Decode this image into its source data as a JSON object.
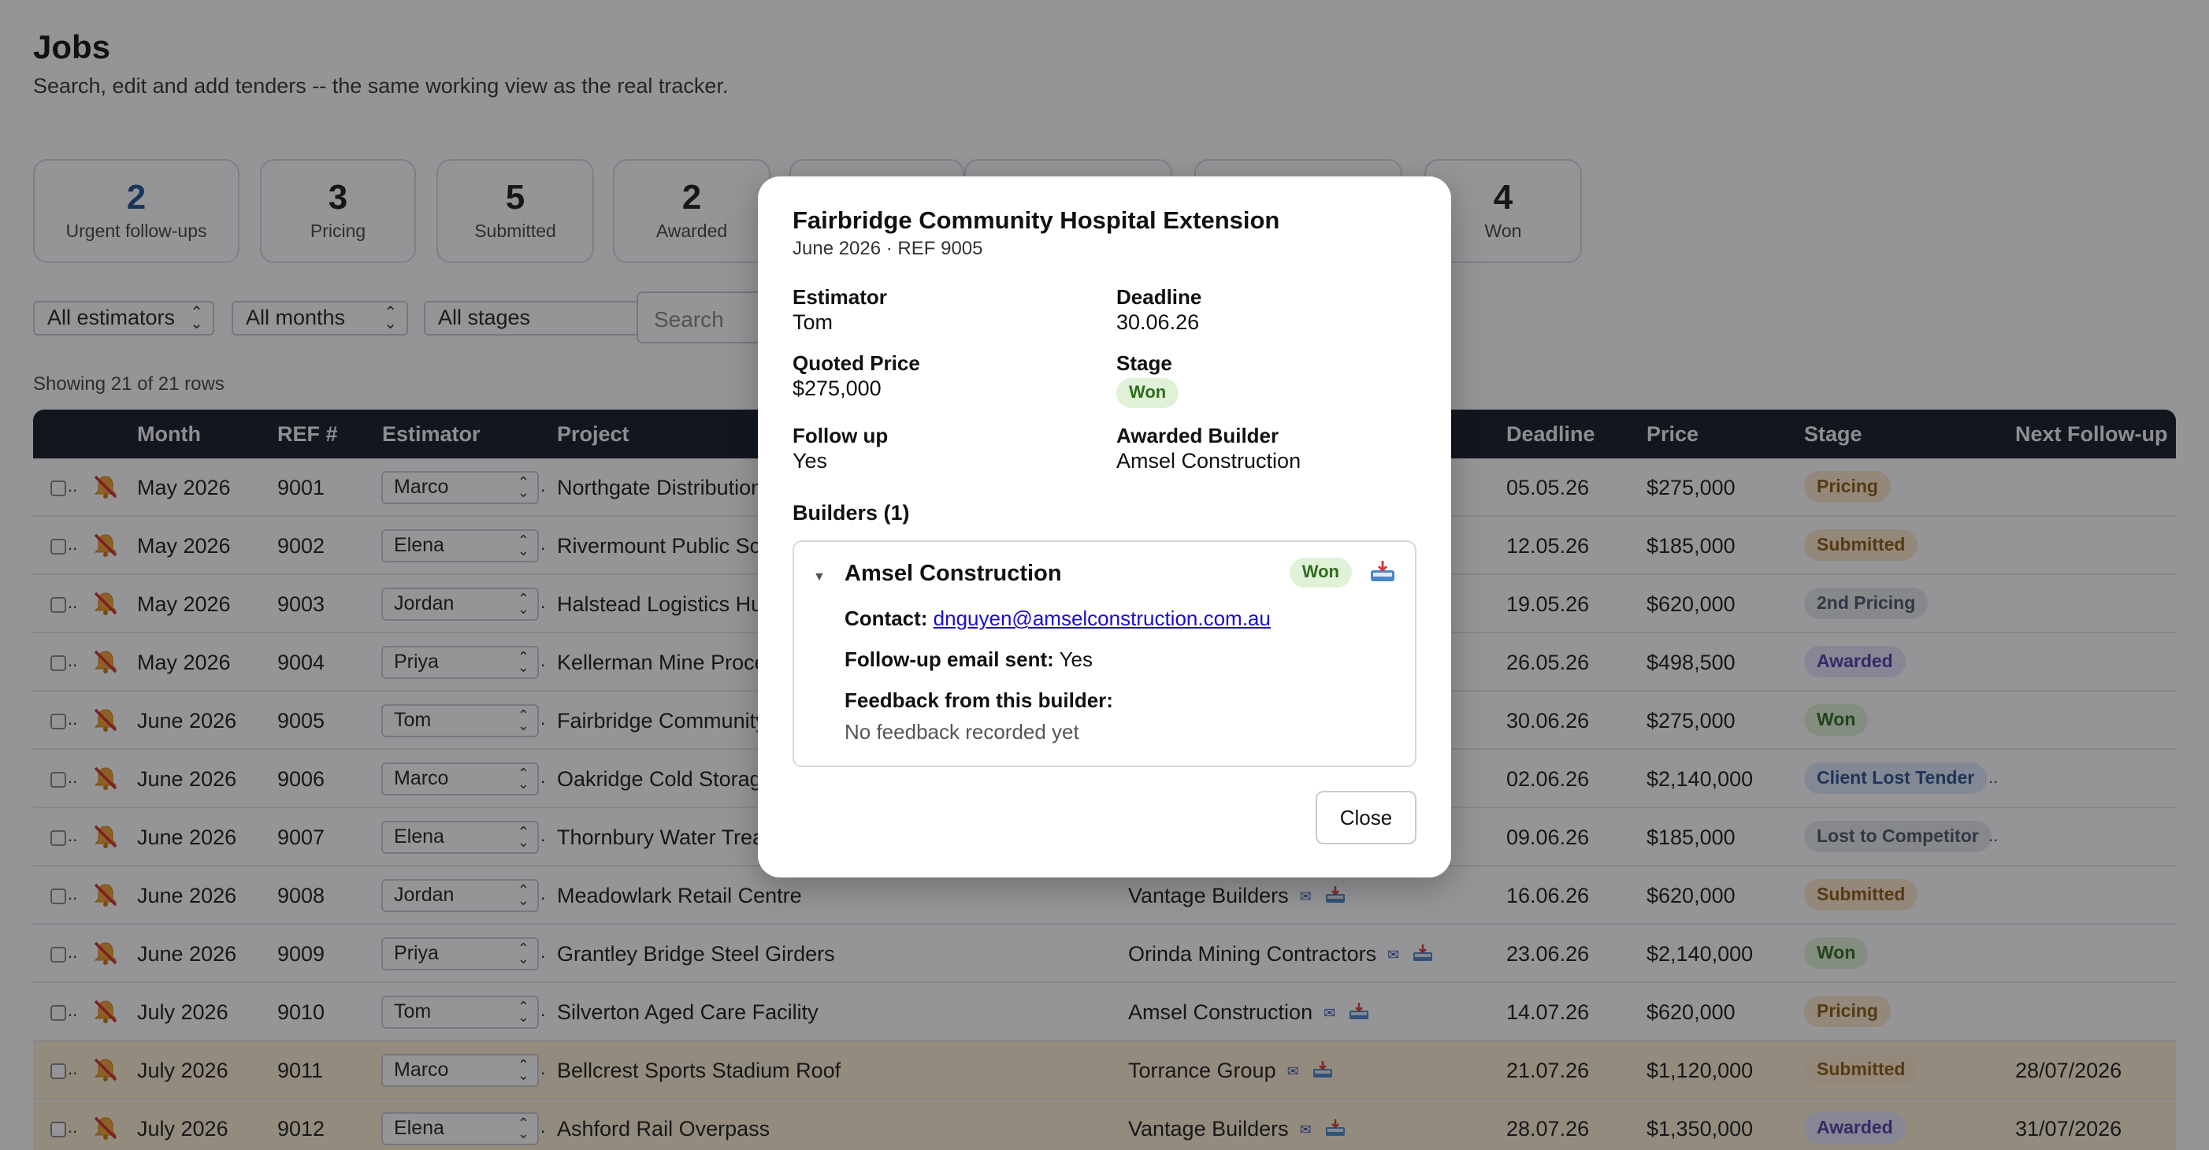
{
  "page": {
    "title": "Jobs",
    "subtitle": "Search, edit and add tenders -- the same working view as the real tracker."
  },
  "cards": [
    {
      "value": "2",
      "label": "Urgent follow-ups"
    },
    {
      "value": "3",
      "label": "Pricing"
    },
    {
      "value": "5",
      "label": "Submitted"
    },
    {
      "value": "2",
      "label": "Awarded"
    },
    {
      "value": "4",
      "label": "Won"
    }
  ],
  "filters": {
    "estimators": "All estimators",
    "months": "All months",
    "stages": "All stages",
    "search_placeholder": "Search"
  },
  "row_count": "Showing 21 of 21 rows",
  "table": {
    "headers": {
      "month": "Month",
      "ref": "REF #",
      "estimator": "Estimator",
      "project": "Project",
      "deadline": "Deadline",
      "price": "Price",
      "stage": "Stage",
      "next": "Next Follow-up"
    },
    "rows": [
      {
        "month": "May 2026",
        "ref": "9001",
        "estimator": "Marco",
        "project": "Northgate Distribution",
        "builder": "",
        "deadline": "05.05.26",
        "price": "$275,000",
        "stage": "Pricing",
        "next": ""
      },
      {
        "month": "May 2026",
        "ref": "9002",
        "estimator": "Elena",
        "project": "Rivermount Public Sch",
        "builder": "",
        "deadline": "12.05.26",
        "price": "$185,000",
        "stage": "Submitted",
        "next": ""
      },
      {
        "month": "May 2026",
        "ref": "9003",
        "estimator": "Jordan",
        "project": "Halstead Logistics Hu",
        "builder": "",
        "deadline": "19.05.26",
        "price": "$620,000",
        "stage": "2nd Pricing",
        "next": ""
      },
      {
        "month": "May 2026",
        "ref": "9004",
        "estimator": "Priya",
        "project": "Kellerman Mine Proce",
        "builder": "",
        "deadline": "26.05.26",
        "price": "$498,500",
        "stage": "Awarded",
        "next": ""
      },
      {
        "month": "June 2026",
        "ref": "9005",
        "estimator": "Tom",
        "project": "Fairbridge Community",
        "builder": "",
        "deadline": "30.06.26",
        "price": "$275,000",
        "stage": "Won",
        "next": ""
      },
      {
        "month": "June 2026",
        "ref": "9006",
        "estimator": "Marco",
        "project": "Oakridge Cold Storag",
        "builder": "",
        "deadline": "02.06.26",
        "price": "$2,140,000",
        "stage": "Client Lost Tender",
        "next": ".."
      },
      {
        "month": "June 2026",
        "ref": "9007",
        "estimator": "Elena",
        "project": "Thornbury Water Trea",
        "builder": "",
        "deadline": "09.06.26",
        "price": "$185,000",
        "stage": "Lost to Competitor",
        "next": ".."
      },
      {
        "month": "June 2026",
        "ref": "9008",
        "estimator": "Jordan",
        "project": "Meadowlark Retail Centre",
        "builder": "Vantage Builders",
        "deadline": "16.06.26",
        "price": "$620,000",
        "stage": "Submitted",
        "next": ""
      },
      {
        "month": "June 2026",
        "ref": "9009",
        "estimator": "Priya",
        "project": "Grantley Bridge Steel Girders",
        "builder": "Orinda Mining Contractors",
        "deadline": "23.06.26",
        "price": "$2,140,000",
        "stage": "Won",
        "next": ""
      },
      {
        "month": "July 2026",
        "ref": "9010",
        "estimator": "Tom",
        "project": "Silverton Aged Care Facility",
        "builder": "Amsel Construction",
        "deadline": "14.07.26",
        "price": "$620,000",
        "stage": "Pricing",
        "next": ""
      },
      {
        "month": "July 2026",
        "ref": "9011",
        "estimator": "Marco",
        "project": "Bellcrest Sports Stadium Roof",
        "builder": "Torrance Group",
        "deadline": "21.07.26",
        "price": "$1,120,000",
        "stage": "Submitted",
        "next": "28/07/2026"
      },
      {
        "month": "July 2026",
        "ref": "9012",
        "estimator": "Elena",
        "project": "Ashford Rail Overpass",
        "builder": "Vantage Builders",
        "deadline": "28.07.26",
        "price": "$1,350,000",
        "stage": "Awarded",
        "next": "31/07/2026"
      }
    ]
  },
  "modal": {
    "title": "Fairbridge Community Hospital Extension",
    "subtitle": "June 2026 · REF 9005",
    "estimator_label": "Estimator",
    "estimator": "Tom",
    "deadline_label": "Deadline",
    "deadline": "30.06.26",
    "price_label": "Quoted Price",
    "price": "$275,000",
    "stage_label": "Stage",
    "stage": "Won",
    "followup_label": "Follow up",
    "followup": "Yes",
    "awarded_label": "Awarded Builder",
    "awarded": "Amsel Construction",
    "builders_heading": "Builders (1)",
    "builder": {
      "name": "Amsel Construction",
      "status": "Won",
      "contact_label": "Contact:",
      "contact": "dnguyen@amselconstruction.com.au",
      "email_label": "Follow-up email sent:",
      "email_value": "Yes",
      "feedback_label": "Feedback from this builder:",
      "feedback": "No feedback recorded yet"
    },
    "close_label": "Close"
  },
  "icons": {
    "bell": "bell-off-icon",
    "mail": "mail-icon",
    "inbox": "inbox-tray-icon",
    "chevron": "chevron-updown-icon"
  },
  "colors": {
    "header_bg": "#121a26",
    "accent": "#1d4f91",
    "highlight_row": "#fbefd2"
  }
}
